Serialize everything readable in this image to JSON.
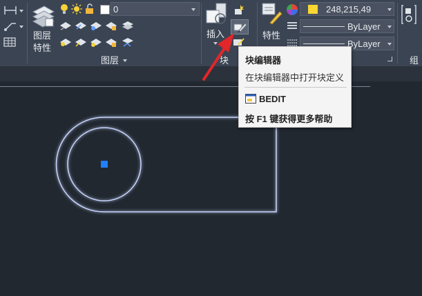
{
  "ribbon": {
    "layer_props_label_1": "图层",
    "layer_props_label_2": "特性",
    "layer_dropdown_value": "0",
    "layers_panel_label": "图层",
    "insert_label": "插入",
    "block_panel_label": "块",
    "properties_label_1": "特性",
    "color_value": "248,215,49",
    "color_swatch": "#f8d731",
    "linetype_value": "ByLayer",
    "lineweight_value": "ByLayer",
    "group_label": "组"
  },
  "tooltip": {
    "title": "块编辑器",
    "description": "在块编辑器中打开块定义",
    "command": "BEDIT",
    "help": "按 F1 键获得更多帮助"
  },
  "colors": {
    "ribbon_bg": "#3b4453",
    "canvas_bg": "#212830",
    "outline": "#c9d6ff",
    "glow": "#3c6cff",
    "grip": "#1f7fff",
    "annotation_arrow": "#e3262a"
  }
}
